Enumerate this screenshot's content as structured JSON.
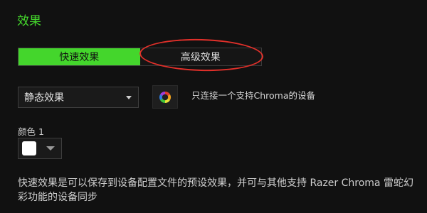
{
  "section": {
    "title": "效果"
  },
  "effect_tabs": {
    "quick_label": "快速效果",
    "advanced_label": "高级效果",
    "active": "quick"
  },
  "effect_select": {
    "selected": "静态效果"
  },
  "chroma": {
    "icon": "chroma-icon",
    "note": "只连接一个支持Chroma的设备"
  },
  "color1": {
    "label": "颜色 1",
    "value": "#ffffff"
  },
  "description": {
    "text": "快速效果是可以保存到设备配置文件的预设效果，并可与其他支持 Razer Chroma 雷蛇幻彩功能的设备同步"
  },
  "colors": {
    "accent_green": "#44d62c",
    "background": "#111111",
    "annotation_red": "#e1302a"
  }
}
